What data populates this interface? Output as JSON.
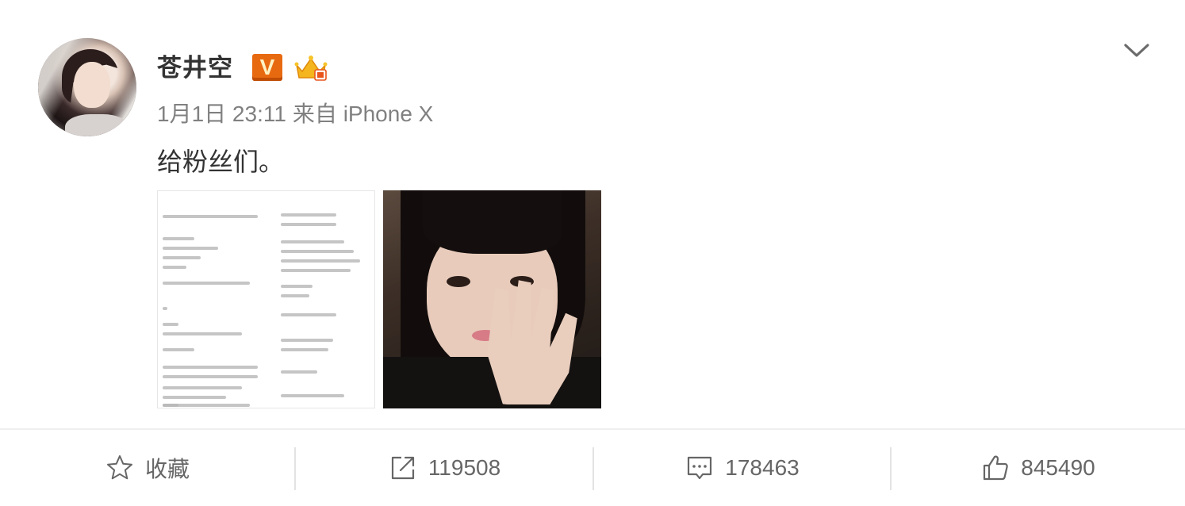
{
  "post": {
    "username": "苍井空",
    "verified_badge": "V",
    "badge_icons": [
      "verified-v-icon",
      "vip-crown-icon"
    ],
    "date": "1月1日 23:11",
    "source": "来自 iPhone X",
    "text": "给粉丝们。",
    "images": [
      "letter-image",
      "selfie-image"
    ]
  },
  "actions": {
    "favorite_label": "收藏",
    "repost_count": "119508",
    "comment_count": "178463",
    "like_count": "845490"
  },
  "colors": {
    "badge_orange": "#e86a10",
    "text_primary": "#333333",
    "text_meta": "#808080",
    "icon_gray": "#666666"
  }
}
